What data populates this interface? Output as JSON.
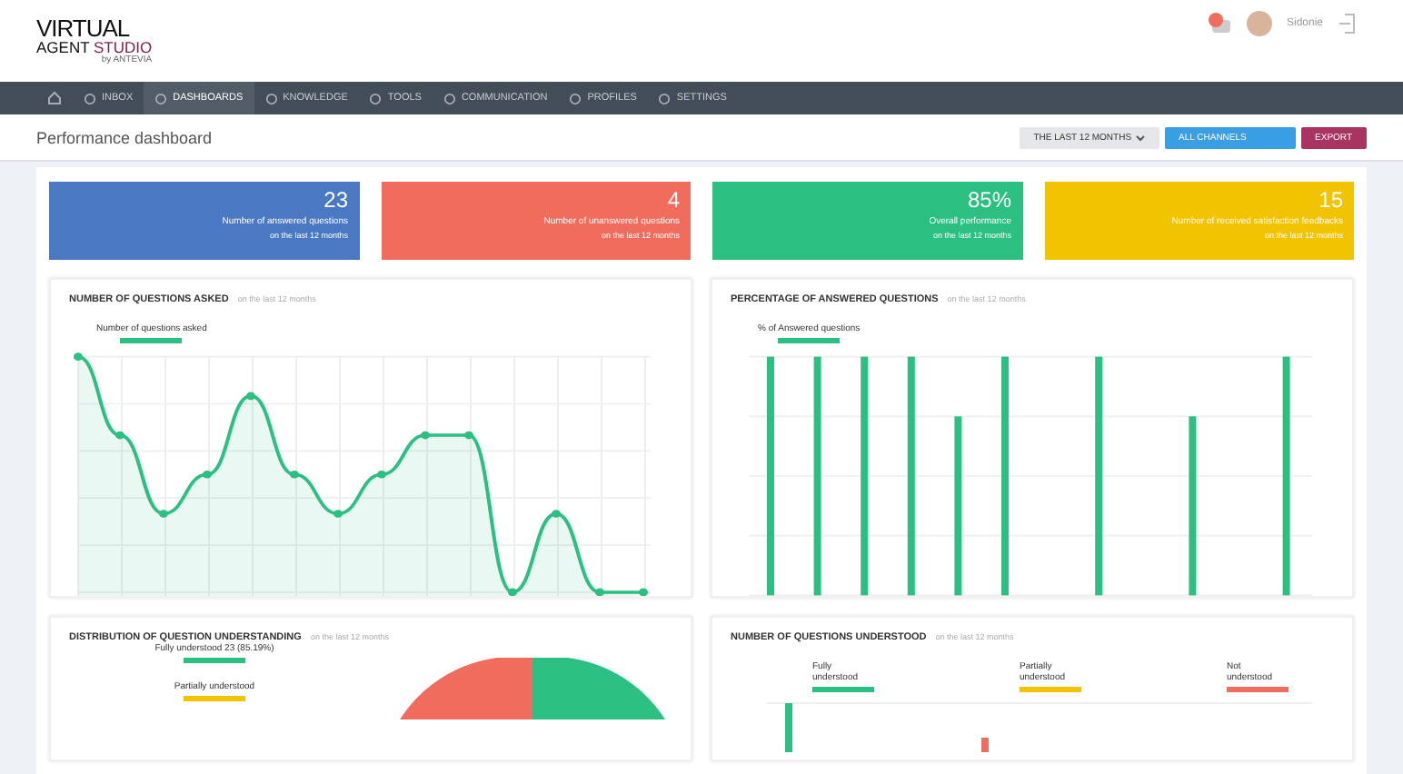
{
  "header": {
    "logo_line1": "VIRTUAL",
    "logo_line2a": "AGENT",
    "logo_line2b": "STUDIO",
    "logo_byline": "by ANTEVIA",
    "user_name": "Sidonie"
  },
  "nav": [
    {
      "selected": false
    },
    {
      "label": "INBOX",
      "selected": false
    },
    {
      "label": "DASHBOARDS",
      "selected": true
    },
    {
      "label": "KNOWLEDGE",
      "selected": false
    },
    {
      "label": "TOOLS",
      "selected": false
    },
    {
      "label": "COMMUNICATION",
      "selected": false
    },
    {
      "label": "PROFILES",
      "selected": false
    },
    {
      "label": "SETTINGS",
      "selected": false
    }
  ],
  "page_title": "Performance dashboard",
  "toolbar": {
    "period": "THE LAST 12 MONTHS",
    "channels": "ALL CHANNELS",
    "export": "EXPORT"
  },
  "stats": [
    {
      "value": "23",
      "label": "Number of answered questions",
      "sub": "on the last 12 months",
      "color": "#4a78c2"
    },
    {
      "value": "4",
      "label": "Number of unanswered questions",
      "sub": "on the last 12 months",
      "color": "#f06c5c"
    },
    {
      "value": "85%",
      "label": "Overall performance",
      "sub": "on the last 12 months",
      "color": "#2bbf82"
    },
    {
      "value": "15",
      "label": "Number of received satisfaction feedbacks",
      "sub": "on the last 12 months",
      "color": "#f2c300"
    }
  ],
  "panels": [
    {
      "kind": "line",
      "title": "NUMBER OF QUESTIONS ASKED",
      "sub": "on the last 12 months",
      "legend": [
        {
          "label": "Number of questions asked",
          "color": "#2bbf82"
        }
      ]
    },
    {
      "kind": "bar",
      "title": "PERCENTAGE OF ANSWERED QUESTIONS",
      "sub": "on the last 12 months",
      "legend": [
        {
          "label": "% of Answered questions",
          "color": "#2bbf82"
        }
      ]
    },
    {
      "kind": "pie",
      "title": "DISTRIBUTION OF QUESTION UNDERSTANDING",
      "sub": "on the last 12 months",
      "legend": [
        {
          "label": "Fully understood 23 (85.19%)",
          "color": "#2bbf82"
        },
        {
          "label": "Partially understood",
          "color": "#f2c300"
        }
      ]
    },
    {
      "kind": "multibar",
      "title": "NUMBER OF QUESTIONS UNDERSTOOD",
      "sub": "on the last 12 months",
      "legend": [
        {
          "label": "Fully understood",
          "color": "#2bbf82"
        },
        {
          "label": "Partially understood",
          "color": "#f2c300"
        },
        {
          "label": "Not understood",
          "color": "#f06c5c"
        }
      ]
    }
  ]
}
